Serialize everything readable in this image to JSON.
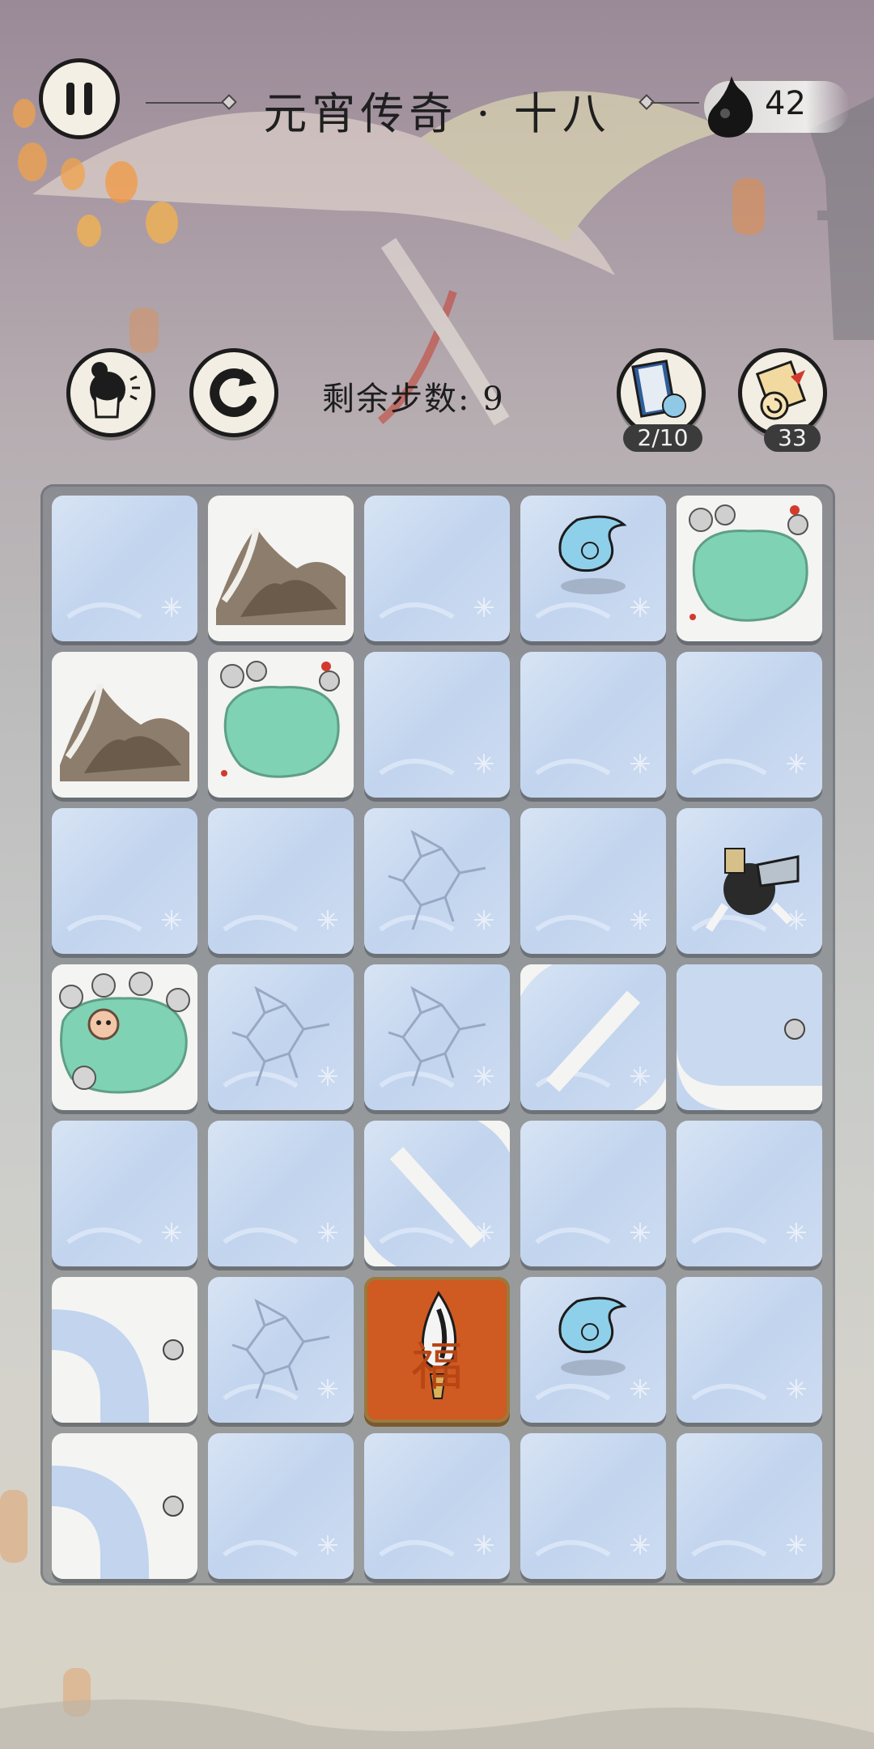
{
  "header": {
    "title": "元宵传奇 · 十八",
    "ink_count": "42"
  },
  "toolbar": {
    "steps_label": "剩余步数: 9",
    "items": [
      {
        "name": "book",
        "count": "2/10"
      },
      {
        "name": "scroll",
        "count": "33"
      }
    ]
  },
  "board": {
    "rows": 7,
    "cols": 5,
    "tiles": [
      [
        "ice",
        "mountain",
        "ice",
        "ice-spirit",
        "pond-flower"
      ],
      [
        "mountain",
        "pond-flower",
        "ice",
        "ice",
        "ice"
      ],
      [
        "ice",
        "ice",
        "cracked-ice",
        "ice",
        "ice-player"
      ],
      [
        "pond-monkey",
        "cracked-ice",
        "cracked-ice",
        "path-diagonal",
        "path-curve"
      ],
      [
        "ice",
        "ice",
        "path-diagonal-rev",
        "ice",
        "ice"
      ],
      [
        "snow-curve",
        "cracked-ice",
        "fu-torch",
        "ice-spirit",
        "ice"
      ],
      [
        "snow-curve",
        "ice",
        "ice",
        "ice",
        "ice"
      ]
    ],
    "fu_glyph": "福"
  },
  "colors": {
    "ice": "#c9d9ef",
    "pond": "#7fd3b4",
    "fu_tile": "#cf5a22",
    "ink": "#1c1c1c"
  }
}
